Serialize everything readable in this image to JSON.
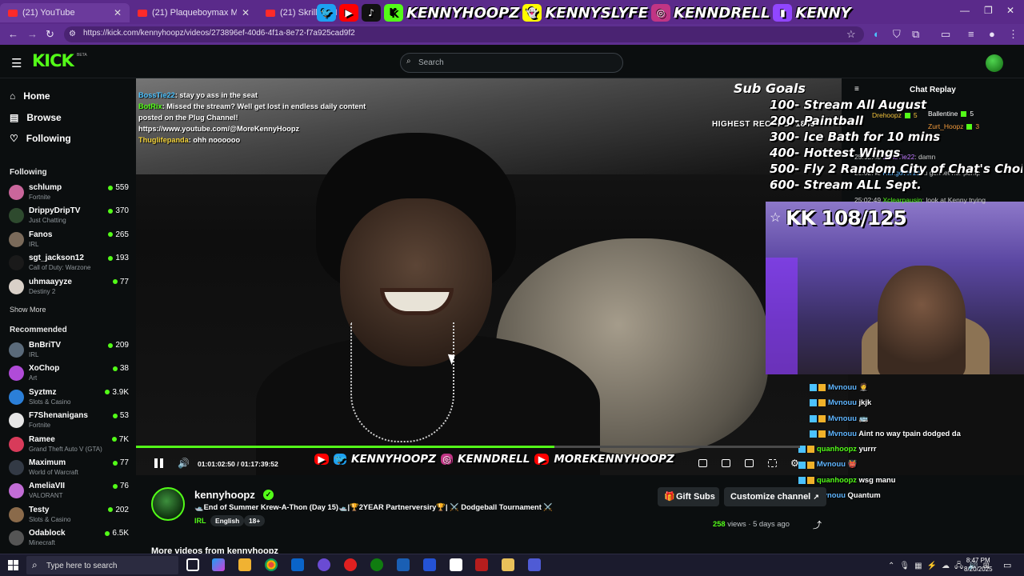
{
  "browser": {
    "tabs": [
      {
        "label": "(21) YouTube"
      },
      {
        "label": "(21) Plaqueboymax Makes Bang"
      },
      {
        "label": "(21) Skrilla - M"
      }
    ],
    "social_handles": [
      "KENNYHOOPZ",
      "KENNYSLYFE",
      "KENNDRELL",
      "KENNY"
    ],
    "url": "https://kick.com/kennyhoopz/videos/273896ef-40d6-4f1a-8e72-f7a925cad9f2"
  },
  "kick": {
    "logo": "KICK",
    "beta": "BETA",
    "search_placeholder": "Search"
  },
  "sidebar": {
    "nav": [
      {
        "label": "Home",
        "icon": "home-icon"
      },
      {
        "label": "Browse",
        "icon": "browse-icon"
      },
      {
        "label": "Following",
        "icon": "heart-icon"
      }
    ],
    "following_title": "Following",
    "following": [
      {
        "name": "schlump",
        "category": "Fortnite",
        "viewers": "559",
        "color": "#c9669b"
      },
      {
        "name": "DrippyDripTV",
        "category": "Just Chatting",
        "viewers": "370",
        "color": "#2e4a2e"
      },
      {
        "name": "Fanos",
        "category": "IRL",
        "viewers": "265",
        "color": "#7a6a5a"
      },
      {
        "name": "sgt_jackson12",
        "category": "Call of Duty: Warzone",
        "viewers": "193",
        "color": "#1a1a1a"
      },
      {
        "name": "uhmaayyze",
        "category": "Destiny 2",
        "viewers": "77",
        "color": "#d9d0c8"
      }
    ],
    "show_more": "Show More",
    "recommended_title": "Recommended",
    "recommended": [
      {
        "name": "BnBriTV",
        "category": "IRL",
        "viewers": "209",
        "color": "#5a6a7a"
      },
      {
        "name": "XoChop",
        "category": "Art",
        "viewers": "38",
        "color": "#b04bd8"
      },
      {
        "name": "Syztmz",
        "category": "Slots & Casino",
        "viewers": "3.9K",
        "color": "#2b7fd8"
      },
      {
        "name": "F7Shenanigans",
        "category": "Fortnite",
        "viewers": "53",
        "color": "#e6e6e6"
      },
      {
        "name": "Ramee",
        "category": "Grand Theft Auto V (GTA)",
        "viewers": "7K",
        "color": "#d83b5a"
      },
      {
        "name": "Maximum",
        "category": "World of Warcraft",
        "viewers": "77",
        "color": "#333a45"
      },
      {
        "name": "AmeliaVII",
        "category": "VALORANT",
        "viewers": "76",
        "color": "#c26dd6"
      },
      {
        "name": "Testy",
        "category": "Slots & Casino",
        "viewers": "202",
        "color": "#8a6a4a"
      },
      {
        "name": "Odablock",
        "category": "Minecraft",
        "viewers": "6.5K",
        "color": "#555"
      }
    ]
  },
  "video": {
    "chat_overlay": [
      {
        "user": "BossTie22",
        "text": ": stay yo ass in the seat"
      },
      {
        "user": "BotRix",
        "text": ": Missed the stream? Well get lost in endless daily content posted on the Plug Channel! https://www.youtube.com/@MoreKennyHoopz"
      },
      {
        "user": "Thuglifepanda",
        "text": ": ohh noooooo"
      }
    ],
    "sub_goals_title": "Sub Goals",
    "sub_goals": [
      "100- Stream All August",
      "200- Paintball",
      "300- Ice Bath for 10 mins",
      "400- Hottest Wings",
      "500- Fly 2 Random City of Chat's Choice",
      "600- Stream ALL Sept."
    ],
    "highest_record": "HIGHEST RECORD: 1845",
    "chat_replay": "Chat Replay",
    "leaderboard": [
      {
        "name": "Ballentine",
        "value": "5"
      },
      {
        "name": "Drehoopz",
        "value": "5"
      },
      {
        "name": "Zurt_Hoopz",
        "value": "3"
      }
    ],
    "replay_msgs": [
      {
        "time": "25:02:48",
        "user": "BossTie22",
        "text": ": damn"
      },
      {
        "time": "25:02:48",
        "user": "Rahgover10",
        "text": ": u gon let her pump"
      },
      {
        "time": "25:02:49",
        "user": "Xclearpausin",
        "text": ": look at Kenny trying"
      }
    ],
    "sub_counter": "KK 108/125",
    "overlay_chat": [
      {
        "user": "Mvnouu",
        "text": "🤵",
        "color": "n1"
      },
      {
        "user": "Mvnouu",
        "text": "jkjk",
        "color": "n1"
      },
      {
        "user": "Mvnouu",
        "text": "🚌",
        "color": "n1"
      },
      {
        "user": "Mvnouu",
        "text": "Aint no way tpain dodged da",
        "color": "n1"
      },
      {
        "user": "quanhoopz",
        "text": "yurrr",
        "color": "n2"
      },
      {
        "user": "Mvnouu",
        "text": "👹",
        "color": "n1"
      },
      {
        "user": "quanhoopz",
        "text": "wsg manu",
        "color": "n2"
      },
      {
        "user": "Mvnouu",
        "text": "Quantum",
        "color": "n1"
      }
    ],
    "time_current": "01:01:02:50",
    "time_total": "01:17:39:52",
    "progress_fraction": 0.63,
    "banner": [
      "KENNYHOOPZ",
      "KENNDRELL",
      "MOREKENNYHOOPZ"
    ]
  },
  "channel": {
    "name": "kennyhoopz",
    "title": "🛥️End of Summer Krew-A-Thon (Day 15)🛥️|🏆2YEAR Partnerversiry🏆| ⚔️ Dodgeball Tournament ⚔️",
    "category": "IRL",
    "tags": [
      "English",
      "18+"
    ],
    "gift_subs": "Gift Subs",
    "customize": "Customize channel",
    "views_count": "258",
    "views_label": "views",
    "posted": "5 days ago",
    "more_videos": "More videos from kennyhoopz"
  },
  "taskbar": {
    "search_placeholder": "Type here to search",
    "time": "8:47 PM",
    "date": "8/20/2025"
  }
}
